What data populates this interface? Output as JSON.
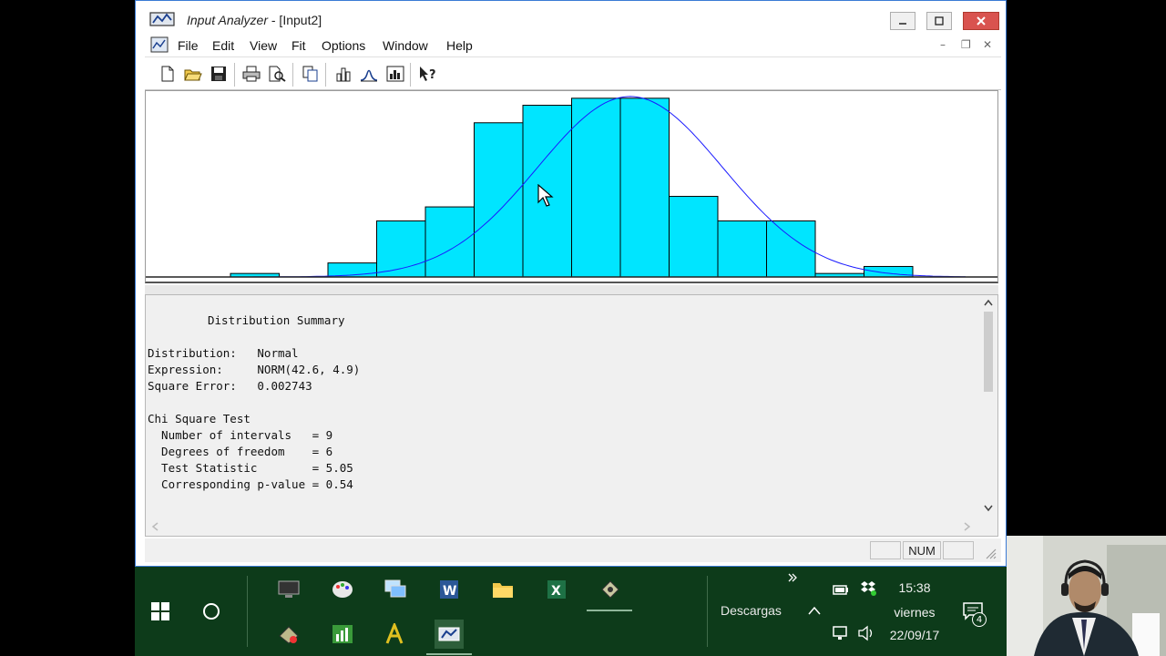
{
  "window": {
    "app_name": "Input Analyzer",
    "doc_name": " - [Input2]"
  },
  "menu": [
    "File",
    "Edit",
    "View",
    "Fit",
    "Options",
    "Window",
    "Help"
  ],
  "chart_data": {
    "type": "bar",
    "title": "",
    "xlabel": "",
    "ylabel": "",
    "values": [
      0.01,
      0,
      0.04,
      0.16,
      0.2,
      0.44,
      0.49,
      0.51,
      0.51,
      0.23,
      0.16,
      0.16,
      0.01,
      0.03
    ],
    "fitted_curve": "normal",
    "bar_color": "#00e5ff",
    "curve_color": "#1a1aff"
  },
  "summary": {
    "heading": "Distribution Summary",
    "lines": [
      "Distribution:   Normal",
      "Expression:     NORM(42.6, 4.9)",
      "Square Error:   0.002743",
      "",
      "Chi Square Test",
      "  Number of intervals   = 9",
      "  Degrees of freedom    = 6",
      "  Test Statistic        = 5.05",
      "  Corresponding p-value = 0.54"
    ]
  },
  "status": {
    "num": "NUM"
  },
  "taskbar": {
    "tray_label": "Descargas",
    "time": "15:38",
    "day": "viernes",
    "date": "22/09/17",
    "notif_count": "4"
  },
  "colors": {
    "taskbar": "#0d3b1a",
    "close_button": "#d9534f",
    "histogram": "#00e5ff"
  }
}
